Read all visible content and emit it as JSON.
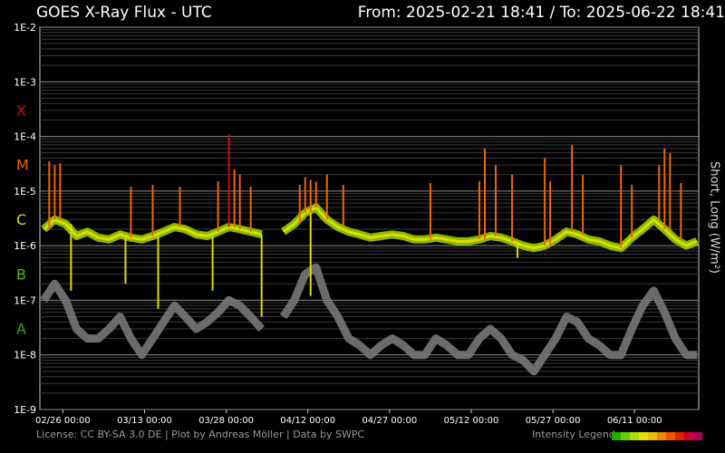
{
  "header": {
    "title": "GOES X-Ray Flux - UTC",
    "range": "From: 2025-02-21 18:41  /  To: 2025-06-22 18:41"
  },
  "footer": {
    "license": "License: CC BY-SA 3.0 DE | Plot by Andreas Möller | Data by SWPC",
    "legend_label": "Intensity Legend",
    "legend_colors": [
      "#22aa00",
      "#66cc00",
      "#aadd00",
      "#dddd00",
      "#eebb00",
      "#ee8800",
      "#ee5500",
      "#dd2200",
      "#cc0033",
      "#aa0055"
    ]
  },
  "side_label": "Short, Long (W/m²)",
  "chart_data": {
    "type": "line",
    "y_scale": "log",
    "ylim_exponent": [
      -9,
      -2
    ],
    "ytick_labels": [
      "1E-2",
      "1E-3",
      "1E-4",
      "1E-5",
      "1E-6",
      "1E-7",
      "1E-8",
      "1E-9"
    ],
    "flare_classes": [
      {
        "label": "X",
        "color": "#cc1111"
      },
      {
        "label": "M",
        "color": "#ee6600"
      },
      {
        "label": "C",
        "color": "#dddd00"
      },
      {
        "label": "B",
        "color": "#55bb00"
      },
      {
        "label": "A",
        "color": "#22aa22"
      }
    ],
    "xlim": [
      "2025-02-21 18:41",
      "2025-06-22 18:41"
    ],
    "xticks": [
      "02/26 00:00",
      "03/13 00:00",
      "03/28 00:00",
      "04/12 00:00",
      "04/27 00:00",
      "05/12 00:00",
      "05/27 00:00",
      "06/11 00:00"
    ],
    "series": [
      {
        "color": "#dddd00",
        "x": [
          "2025-02-22",
          "2025-02-24",
          "2025-02-26",
          "2025-02-28",
          "2025-03-02",
          "2025-03-04",
          "2025-03-06",
          "2025-03-08",
          "2025-03-10",
          "2025-03-12",
          "2025-03-14",
          "2025-03-16",
          "2025-03-18",
          "2025-03-20",
          "2025-03-22",
          "2025-03-24",
          "2025-03-26",
          "2025-03-28",
          "2025-03-30",
          "2025-04-01",
          "2025-04-03",
          "2025-04-05",
          "2025-04-07",
          "2025-04-09",
          "2025-04-11",
          "2025-04-13",
          "2025-04-15",
          "2025-04-17",
          "2025-04-19",
          "2025-04-21",
          "2025-04-23",
          "2025-04-25",
          "2025-04-27",
          "2025-04-29",
          "2025-05-01",
          "2025-05-03",
          "2025-05-05",
          "2025-05-07",
          "2025-05-09",
          "2025-05-11",
          "2025-05-13",
          "2025-05-15",
          "2025-05-17",
          "2025-05-19",
          "2025-05-21",
          "2025-05-23",
          "2025-05-25",
          "2025-05-27",
          "2025-05-29",
          "2025-05-31",
          "2025-06-02",
          "2025-06-04",
          "2025-06-06",
          "2025-06-08",
          "2025-06-10",
          "2025-06-12",
          "2025-06-14",
          "2025-06-16",
          "2025-06-18",
          "2025-06-20",
          "2025-06-22"
        ],
        "y": [
          2e-06,
          3e-06,
          2.5e-06,
          1.5e-06,
          1.8e-06,
          1.4e-06,
          1.3e-06,
          1.6e-06,
          1.4e-06,
          1.3e-06,
          1.5e-06,
          1.8e-06,
          2.2e-06,
          2e-06,
          1.6e-06,
          1.5e-06,
          1.8e-06,
          2.2e-06,
          2e-06,
          1.8e-06,
          1.6e-06,
          null,
          1.8e-06,
          2.5e-06,
          4e-06,
          5e-06,
          3e-06,
          2.2e-06,
          1.8e-06,
          1.6e-06,
          1.4e-06,
          1.5e-06,
          1.6e-06,
          1.5e-06,
          1.3e-06,
          1.3e-06,
          1.4e-06,
          1.3e-06,
          1.2e-06,
          1.2e-06,
          1.3e-06,
          1.5e-06,
          1.4e-06,
          1.2e-06,
          1e-06,
          9e-07,
          1e-06,
          1.3e-06,
          1.8e-06,
          1.6e-06,
          1.3e-06,
          1.2e-06,
          1e-06,
          9e-07,
          1.4e-06,
          2e-06,
          3e-06,
          2e-06,
          1.3e-06,
          1e-06,
          1.2e-06
        ]
      },
      {
        "color": "#777777",
        "x": [
          "2025-02-22",
          "2025-02-24",
          "2025-02-26",
          "2025-02-28",
          "2025-03-02",
          "2025-03-04",
          "2025-03-06",
          "2025-03-08",
          "2025-03-10",
          "2025-03-12",
          "2025-03-14",
          "2025-03-16",
          "2025-03-18",
          "2025-03-20",
          "2025-03-22",
          "2025-03-24",
          "2025-03-26",
          "2025-03-28",
          "2025-03-30",
          "2025-04-01",
          "2025-04-03",
          "2025-04-05",
          "2025-04-07",
          "2025-04-09",
          "2025-04-11",
          "2025-04-13",
          "2025-04-15",
          "2025-04-17",
          "2025-04-19",
          "2025-04-21",
          "2025-04-23",
          "2025-04-25",
          "2025-04-27",
          "2025-04-29",
          "2025-05-01",
          "2025-05-03",
          "2025-05-05",
          "2025-05-07",
          "2025-05-09",
          "2025-05-11",
          "2025-05-13",
          "2025-05-15",
          "2025-05-17",
          "2025-05-19",
          "2025-05-21",
          "2025-05-23",
          "2025-05-25",
          "2025-05-27",
          "2025-05-29",
          "2025-05-31",
          "2025-06-02",
          "2025-06-04",
          "2025-06-06",
          "2025-06-08",
          "2025-06-10",
          "2025-06-12",
          "2025-06-14",
          "2025-06-16",
          "2025-06-18",
          "2025-06-20",
          "2025-06-22"
        ],
        "y": [
          1e-07,
          2e-07,
          1e-07,
          3e-08,
          2e-08,
          2e-08,
          3e-08,
          5e-08,
          2e-08,
          1e-08,
          2e-08,
          4e-08,
          8e-08,
          5e-08,
          3e-08,
          4e-08,
          6e-08,
          1e-07,
          8e-08,
          5e-08,
          3e-08,
          null,
          5e-08,
          1e-07,
          3e-07,
          4e-07,
          1e-07,
          5e-08,
          2e-08,
          1.5e-08,
          1e-08,
          1.5e-08,
          2e-08,
          1.5e-08,
          1e-08,
          1e-08,
          2e-08,
          1.5e-08,
          1e-08,
          1e-08,
          2e-08,
          3e-08,
          2e-08,
          1e-08,
          8e-09,
          5e-09,
          1e-08,
          2e-08,
          5e-08,
          4e-08,
          2e-08,
          1.5e-08,
          1e-08,
          1e-08,
          3e-08,
          8e-08,
          1.5e-07,
          6e-08,
          2e-08,
          1e-08,
          1e-08
        ]
      }
    ],
    "peaks": [
      {
        "x": "2025-02-23",
        "y": 3.5e-05
      },
      {
        "x": "2025-02-24",
        "y": 3e-05
      },
      {
        "x": "2025-02-25",
        "y": 3.2e-05
      },
      {
        "x": "2025-03-10",
        "y": 1.2e-05
      },
      {
        "x": "2025-03-14",
        "y": 1.3e-05
      },
      {
        "x": "2025-03-19",
        "y": 1.2e-05
      },
      {
        "x": "2025-03-26",
        "y": 1.5e-05
      },
      {
        "x": "2025-03-28",
        "y": 0.00011
      },
      {
        "x": "2025-03-29",
        "y": 2.5e-05
      },
      {
        "x": "2025-03-30",
        "y": 2e-05
      },
      {
        "x": "2025-04-01",
        "y": 1.2e-05
      },
      {
        "x": "2025-04-10",
        "y": 1.3e-05
      },
      {
        "x": "2025-04-11",
        "y": 1.8e-05
      },
      {
        "x": "2025-04-12",
        "y": 1.6e-05
      },
      {
        "x": "2025-04-13",
        "y": 1.5e-05
      },
      {
        "x": "2025-04-15",
        "y": 2e-05
      },
      {
        "x": "2025-04-18",
        "y": 1.3e-05
      },
      {
        "x": "2025-05-04",
        "y": 1.4e-05
      },
      {
        "x": "2025-05-13",
        "y": 1.5e-05
      },
      {
        "x": "2025-05-14",
        "y": 6e-05
      },
      {
        "x": "2025-05-16",
        "y": 3e-05
      },
      {
        "x": "2025-05-19",
        "y": 2e-05
      },
      {
        "x": "2025-05-25",
        "y": 4e-05
      },
      {
        "x": "2025-05-26",
        "y": 1.5e-05
      },
      {
        "x": "2025-05-30",
        "y": 7e-05
      },
      {
        "x": "2025-06-01",
        "y": 2e-05
      },
      {
        "x": "2025-06-08",
        "y": 3e-05
      },
      {
        "x": "2025-06-10",
        "y": 1.3e-05
      },
      {
        "x": "2025-06-15",
        "y": 3e-05
      },
      {
        "x": "2025-06-16",
        "y": 6e-05
      },
      {
        "x": "2025-06-17",
        "y": 5e-05
      },
      {
        "x": "2025-06-19",
        "y": 1.4e-05
      }
    ],
    "dips": [
      {
        "x": "2025-02-27",
        "y": 1.5e-07
      },
      {
        "x": "2025-03-09",
        "y": 2e-07
      },
      {
        "x": "2025-03-15",
        "y": 7e-08
      },
      {
        "x": "2025-03-25",
        "y": 1.5e-07
      },
      {
        "x": "2025-04-03",
        "y": 5e-08
      },
      {
        "x": "2025-04-12",
        "y": 1.2e-07
      },
      {
        "x": "2025-05-20",
        "y": 6e-07
      }
    ]
  }
}
